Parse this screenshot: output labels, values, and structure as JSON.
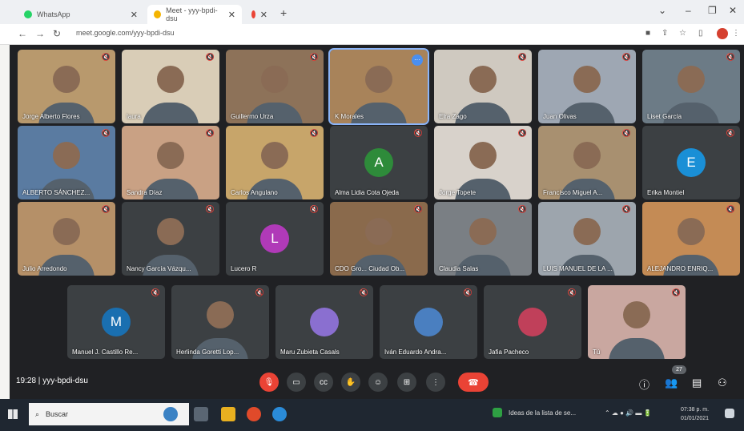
{
  "browser": {
    "tabs": [
      {
        "label": "WhatsApp",
        "color": "#25d366"
      },
      {
        "label": "Meet - yyy-bpdi-dsu",
        "color": "#f4b400"
      },
      {
        "label": "",
        "color": "#ea4335"
      }
    ],
    "url": "meet.google.com/yyy-bpdi-dsu"
  },
  "participants": [
    {
      "name": "Jorge Alberto Flores",
      "kind": "video",
      "bg": "#b8996d"
    },
    {
      "name": "laura",
      "kind": "video",
      "bg": "#d9cdb7"
    },
    {
      "name": "Guillermo Urza",
      "kind": "video",
      "bg": "#8d7259"
    },
    {
      "name": "K Morales",
      "kind": "video",
      "bg": "#a8835a"
    },
    {
      "name": "Elra Zago",
      "kind": "video",
      "bg": "#cfc9c0"
    },
    {
      "name": "Juan Olivas",
      "kind": "video",
      "bg": "#9ea7b3"
    },
    {
      "name": "Liset García",
      "kind": "video",
      "bg": "#6c7b86"
    },
    {
      "name": "ALBERTO SÁNCHEZ...",
      "kind": "video",
      "bg": "#5a7ba1"
    },
    {
      "name": "Sandra Díaz",
      "kind": "video",
      "bg": "#c9a184"
    },
    {
      "name": "Carlos Angulano",
      "kind": "video",
      "bg": "#c7a56a"
    },
    {
      "name": "Alma Lidia Cota Ojeda",
      "kind": "avatar",
      "letter": "A",
      "bg": "#3c4043",
      "avatar_color": "#2e8b3a"
    },
    {
      "name": "Jorge Topete",
      "kind": "video",
      "bg": "#d8d2cb"
    },
    {
      "name": "Francisco Miguel A...",
      "kind": "video",
      "bg": "#a89070"
    },
    {
      "name": "Erika Montiel",
      "kind": "avatar",
      "letter": "E",
      "bg": "#3c4043",
      "avatar_color": "#1a8fd6"
    },
    {
      "name": "Julio Arredondo",
      "kind": "video",
      "bg": "#b59068"
    },
    {
      "name": "Nancy García Vázqu...",
      "kind": "video",
      "bg": "#3c4043"
    },
    {
      "name": "Lucero R",
      "kind": "avatar",
      "letter": "L",
      "bg": "#3c4043",
      "avatar_color": "#b03ab8"
    },
    {
      "name": "CDO Gro... Ciudad Ob...",
      "kind": "video",
      "bg": "#8a6a4c"
    },
    {
      "name": "Claudia Salas",
      "kind": "video",
      "bg": "#7a7f84"
    },
    {
      "name": "LUIS MANUEL DE LA ...",
      "kind": "video",
      "bg": "#9da5ad"
    },
    {
      "name": "ALEJANDRO ENRIQ...",
      "kind": "video",
      "bg": "#c48b55"
    },
    {
      "name": "Manuel J. Castillo Re...",
      "kind": "avatar",
      "letter": "M",
      "bg": "#3c4043",
      "avatar_color": "#1a6fb0"
    },
    {
      "name": "Herlinda Goretti Lop...",
      "kind": "video",
      "bg": "#3c4043"
    },
    {
      "name": "Maru Zubieta Casals",
      "kind": "avatar",
      "letter": "",
      "bg": "#3c4043",
      "avatar_color": "#8a6fd0"
    },
    {
      "name": "Iván Eduardo Andra...",
      "kind": "avatar",
      "letter": "",
      "bg": "#3c4043",
      "avatar_color": "#4a7fc0"
    },
    {
      "name": "Jafia Pacheco",
      "kind": "avatar",
      "letter": "",
      "bg": "#3c4043",
      "avatar_color": "#c0405a"
    },
    {
      "name": "Tú",
      "kind": "video",
      "bg": "#c9a7a0"
    }
  ],
  "bottom_bar": {
    "time": "19:28",
    "meeting_code": "yyy-bpdi-dsu",
    "participant_count": "27"
  },
  "taskbar": {
    "search_placeholder": "Buscar",
    "notification": "Ideas de la lista de se...",
    "time": "07:38 p. m.",
    "date": "01/01/2021"
  }
}
